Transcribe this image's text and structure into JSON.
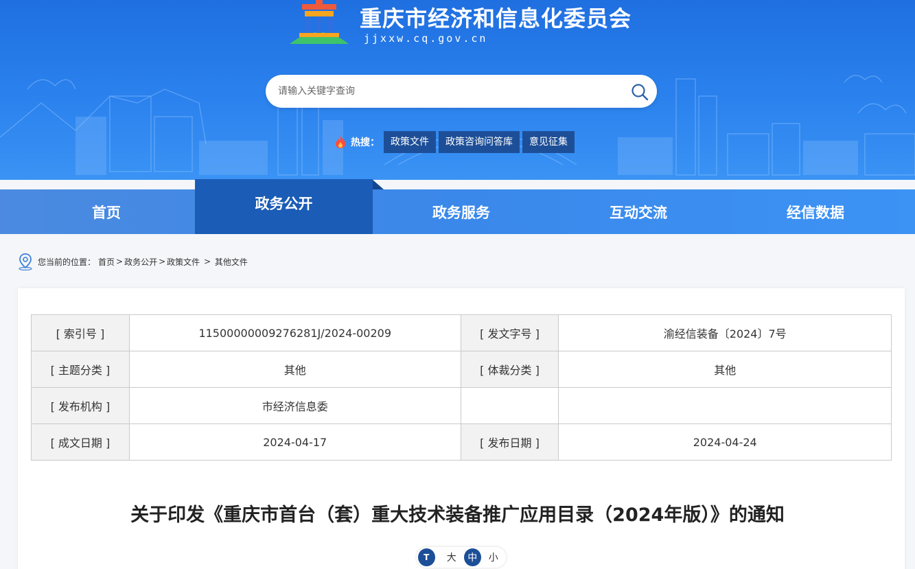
{
  "header": {
    "site_title": "重庆市经济和信息化委员会",
    "site_domain": "jjxxw.cq.gov.cn"
  },
  "search": {
    "placeholder": "请输入关键字查询",
    "icon": "search-icon"
  },
  "hot_search": {
    "label": "热搜：",
    "tags": [
      "政策文件",
      "政策咨询问答库",
      "意见征集"
    ]
  },
  "nav": {
    "items": [
      "首页",
      "政务公开",
      "政务服务",
      "互动交流",
      "经信数据"
    ],
    "active": "政务公开"
  },
  "breadcrumb": {
    "prefix": "您当前的位置：",
    "items": [
      "首页",
      "政务公开",
      "政策文件",
      "其他文件"
    ],
    "separators": [
      ">",
      ">",
      " > "
    ]
  },
  "meta": {
    "index_no_label": "[ 索引号 ]",
    "index_no": "11500000009276281J/2024-00209",
    "doc_no_label": "[ 发文字号 ]",
    "doc_no": "渝经信装备〔2024〕7号",
    "topic_label": "[ 主题分类 ]",
    "topic": "其他",
    "genre_label": "[ 体裁分类 ]",
    "genre": "其他",
    "publisher_label": "[ 发布机构 ]",
    "publisher": "市经济信息委",
    "created_label": "[ 成文日期 ]",
    "created": "2024-04-17",
    "published_label": "[ 发布日期 ]",
    "published": "2024-04-24"
  },
  "document": {
    "title": "关于印发《重庆市首台（套）重大技术装备推广应用目录（2024年版）》的通知"
  },
  "font_size": {
    "icon_text": "T",
    "options": [
      "大",
      "中",
      "小"
    ],
    "selected": "中"
  },
  "colors": {
    "header_blue": "#2b82ee",
    "nav_active": "#1a5cb6",
    "tag_bg": "#1d4f98"
  }
}
